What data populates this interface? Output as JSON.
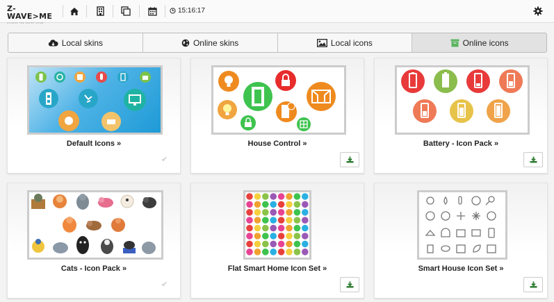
{
  "header": {
    "logo_text": "Z-WAVE>ME",
    "logo_subtext": "ACCESS THE SMART HOME",
    "time": "15:16:17",
    "icons": [
      "home-icon",
      "building-icon",
      "copy-icon",
      "calendar-icon",
      "clock-icon",
      "gear-icon"
    ]
  },
  "tabs": [
    {
      "label": "Local skins",
      "icon": "cloud-download-icon",
      "active": false
    },
    {
      "label": "Online skins",
      "icon": "globe-icon",
      "active": false
    },
    {
      "label": "Local icons",
      "icon": "image-icon",
      "active": false
    },
    {
      "label": "Online icons",
      "icon": "archive-icon",
      "active": true
    }
  ],
  "cards": [
    {
      "title": "Default Icons »",
      "action": "installed"
    },
    {
      "title": "House Control »",
      "action": "download"
    },
    {
      "title": "Battery - Icon Pack »",
      "action": "download"
    },
    {
      "title": "Cats - Icon Pack »",
      "action": "installed"
    },
    {
      "title": "Flat Smart Home Icon Set »",
      "action": "download"
    },
    {
      "title": "Smart House Icon Set »",
      "action": "download"
    }
  ],
  "colors": {
    "download_green": "#2e7d32",
    "house_orange": "#ef8a1f",
    "house_red": "#e82c2c",
    "house_green": "#3ec34e",
    "battery_red": "#e83a3a",
    "battery_green": "#8bbd4c",
    "battery_orange": "#f0a34a",
    "default_bg_blue": "#1e9ad6"
  }
}
